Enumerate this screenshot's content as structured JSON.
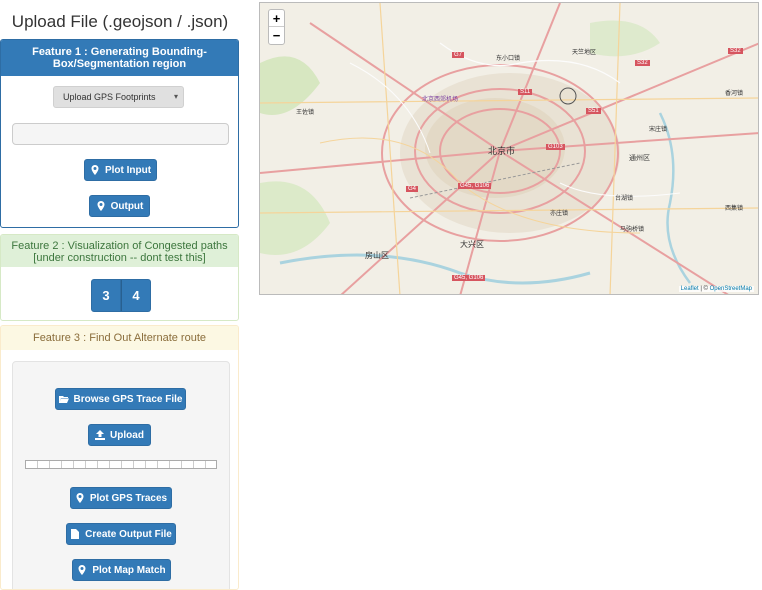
{
  "page_title": "Upload File (.geojson / .json)",
  "feature1": {
    "heading": "Feature 1 : Generating Bounding-Box/Segmentation region",
    "select_label": "Upload GPS Footprints",
    "plot_input_label": "Plot Input",
    "output_label": "Output"
  },
  "feature2": {
    "heading": "Feature 2 : Visualization of Congested paths [under construction -- dont test this]",
    "buttons": [
      "3",
      "4"
    ]
  },
  "feature3": {
    "heading": "Feature 3 : Find Out Alternate route",
    "browse_label": "Browse GPS Trace File",
    "upload_label": "Upload",
    "plot_traces_label": "Plot GPS Traces",
    "create_output_label": "Create Output File",
    "plot_map_label": "Plot Map Match"
  },
  "map": {
    "zoom_in": "+",
    "zoom_out": "−",
    "attribution_leaflet": "Leaflet",
    "attribution_sep": " | © ",
    "attribution_osm": "OpenStreetMap",
    "labels": {
      "city": "北京市",
      "district_tongzhou": "通州区",
      "district_daxing": "大兴区",
      "district_fangshan": "房山区",
      "airport": "北京西郊机场",
      "tianzhu": "天竺地区",
      "s32": "S32",
      "s11": "S11",
      "s51": "S51",
      "g7": "G7",
      "g4": "G4",
      "g103": "G103",
      "g45": "G45, G106",
      "songzhuang": "宋庄镇",
      "wangzuo": "王佐镇",
      "majiapu": "马驹桥镇",
      "tiangong": "台湖镇",
      "yizhuang": "亦庄镇",
      "dongxiaokou": "东小口镇",
      "xiji": "西集镇",
      "xiangyang": "香河镇"
    }
  },
  "colors": {
    "primary": "#337ab7",
    "success_bg": "#dff0d8",
    "warning_bg": "#fcf8e3"
  }
}
